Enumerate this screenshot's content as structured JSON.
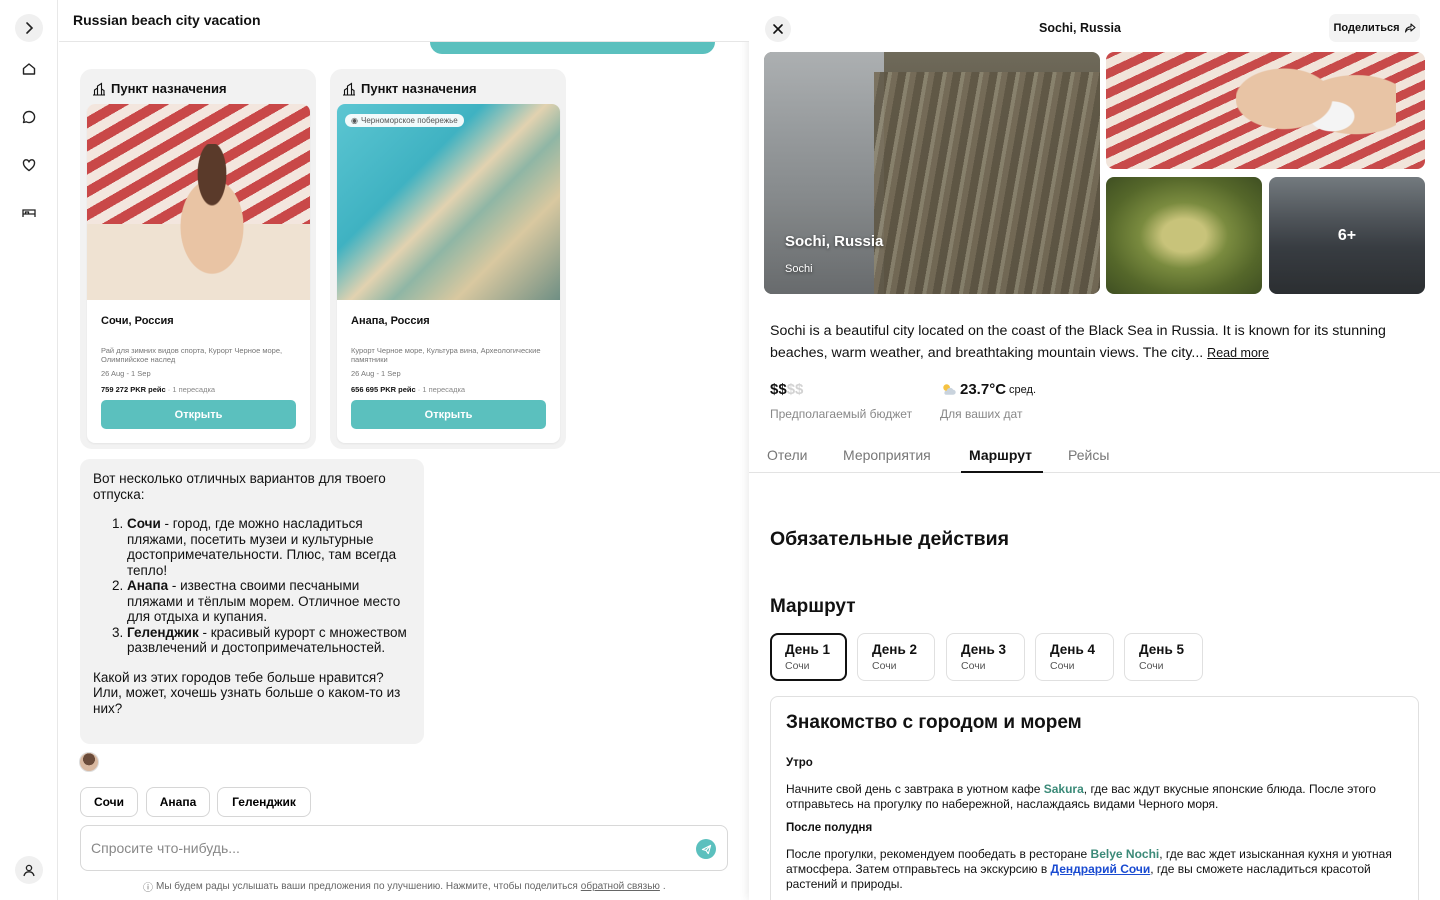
{
  "rail": {
    "icons": [
      "chevron-right-icon",
      "home-icon",
      "chat-icon",
      "heart-icon",
      "bed-icon",
      "user-icon"
    ]
  },
  "chat": {
    "title": "Russian beach city vacation",
    "cards": [
      {
        "header": "Пункт назначения",
        "chip": "",
        "name": "Сочи, Россия",
        "desc": "Рай для зимних видов спорта, Курорт Черное море, Олимпийское наслед",
        "dates": "26 Aug - 1 Sep",
        "price": "759 272 PKR рейс",
        "stops": "· 1 пересадка",
        "button": "Открыть"
      },
      {
        "header": "Пункт назначения",
        "chip": "Черноморское побережье",
        "name": "Анапа, Россия",
        "desc": "Курорт Черное море, Культура вина, Археологические памятники",
        "dates": "26 Aug - 1 Sep",
        "price": "656 695 PKR рейс",
        "stops": "· 1 пересадка",
        "button": "Открыть"
      }
    ],
    "message": {
      "intro": "Вот несколько отличных вариантов для твоего отпуска:",
      "items": [
        {
          "bold": "Сочи",
          "text": " - город, где можно насладиться пляжами, посетить музеи и культурные достопримечательности. Плюс, там всегда тепло!"
        },
        {
          "bold": "Анапа",
          "text": " - известна своими песчаными пляжами и тёплым морем. Отличное место для отдыха и купания."
        },
        {
          "bold": "Геленджик",
          "text": " - красивый курорт с множеством развлечений и достопримечательностей."
        }
      ],
      "outro": "Какой из этих городов тебе больше нравится? Или, может, хочешь узнать больше о каком-то из них?"
    },
    "suggestions": [
      "Сочи",
      "Анапа",
      "Геленджик"
    ],
    "input_placeholder": "Спросите что-нибудь...",
    "footnote": "Мы будем рады услышать ваши предложения по улучшению. Нажмите, чтобы поделиться",
    "footnote_link": "обратной связью",
    "footnote_end": "."
  },
  "panel": {
    "title": "Sochi, Russia",
    "share": "Поделиться",
    "gallery": {
      "label": "Sochi, Russia",
      "sub": "Sochi",
      "more": "6+"
    },
    "description": "Sochi is a beautiful city located on the coast of the Black Sea in Russia. It is known for its stunning beaches, warm weather, and breathtaking mountain views. The city...",
    "read_more": "Read more",
    "budget_strong": "$$",
    "budget_dim": "$$",
    "budget_label": "Предполагаемый бюджет",
    "temp": "23.7°C",
    "temp_suffix": "сред.",
    "temp_label": "Для ваших дат",
    "tabs": [
      "Отели",
      "Мероприятия",
      "Маршрут",
      "Рейсы"
    ],
    "active_tab": "Маршрут",
    "must_do": "Обязательные действия",
    "route": "Маршрут",
    "days": [
      {
        "title": "День 1",
        "city": "Сочи"
      },
      {
        "title": "День 2",
        "city": "Сочи"
      },
      {
        "title": "День 3",
        "city": "Сочи"
      },
      {
        "title": "День 4",
        "city": "Сочи"
      },
      {
        "title": "День 5",
        "city": "Сочи"
      }
    ],
    "plan": {
      "title": "Знакомство с городом и морем",
      "morning": "Утро",
      "morning_pre": "Начните свой день с завтрака в уютном кафе ",
      "morning_hl": "Sakura",
      "morning_post": ", где вас ждут вкусные японские блюда. После этого отправьтесь на прогулку по набережной, наслаждаясь видами Черного моря.",
      "afternoon": "После полудня",
      "afternoon_pre": "После прогулки, рекомендуем пообедать в ресторане ",
      "afternoon_hl": "Belye Nochi",
      "afternoon_mid": ", где вас ждет изысканная кухня и уютная атмосфера. Затем отправьтесь на экскурсию в ",
      "afternoon_link": "Дендрарий Сочи",
      "afternoon_post": ", где вы сможете насладиться красотой растений и природы."
    }
  }
}
